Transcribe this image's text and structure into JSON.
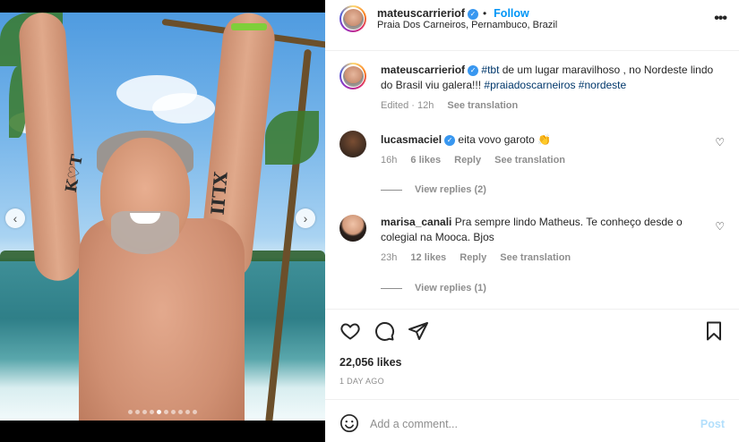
{
  "post": {
    "username": "mateuscarrieriof",
    "follow_label": "Follow",
    "location": "Praia Dos Carneiros, Pernambuco, Brazil",
    "more_label": "•••"
  },
  "caption": {
    "username": "mateuscarrieriof",
    "tag1": "#tbt",
    "text": " de um lugar maravilhoso , no Nordeste lindo do Brasil viu galera!!! ",
    "tag2": "#praiadoscarneiros",
    "tag3": "#nordeste",
    "meta_edited": "Edited · 12h",
    "see_translation": "See translation"
  },
  "comments": [
    {
      "username": "lucasmaciel",
      "text": "eita vovo garoto 👏",
      "time": "16h",
      "likes": "6 likes",
      "reply": "Reply",
      "see_translation": "See translation",
      "view_replies": "View replies (2)"
    },
    {
      "username": "marisa_canali",
      "text": "Pra sempre lindo Matheus. Te conheço desde o colegial na Mooca. Bjos",
      "time": "23h",
      "likes": "12 likes",
      "reply": "Reply",
      "see_translation": "See translation",
      "view_replies": "View replies (1)"
    }
  ],
  "stats": {
    "likes": "22,056 likes",
    "date": "1 DAY AGO"
  },
  "composer": {
    "placeholder": "Add a comment...",
    "post_label": "Post"
  },
  "media": {
    "prev": "‹",
    "next": "›",
    "tattoo_left": "K♡T",
    "tattoo_right": "XLII",
    "dots_total": 10,
    "dots_active": 4
  },
  "icons": {
    "heart": "heart-icon",
    "comment": "comment-icon",
    "share": "share-icon",
    "save": "bookmark-icon",
    "emoji": "emoji-icon"
  }
}
